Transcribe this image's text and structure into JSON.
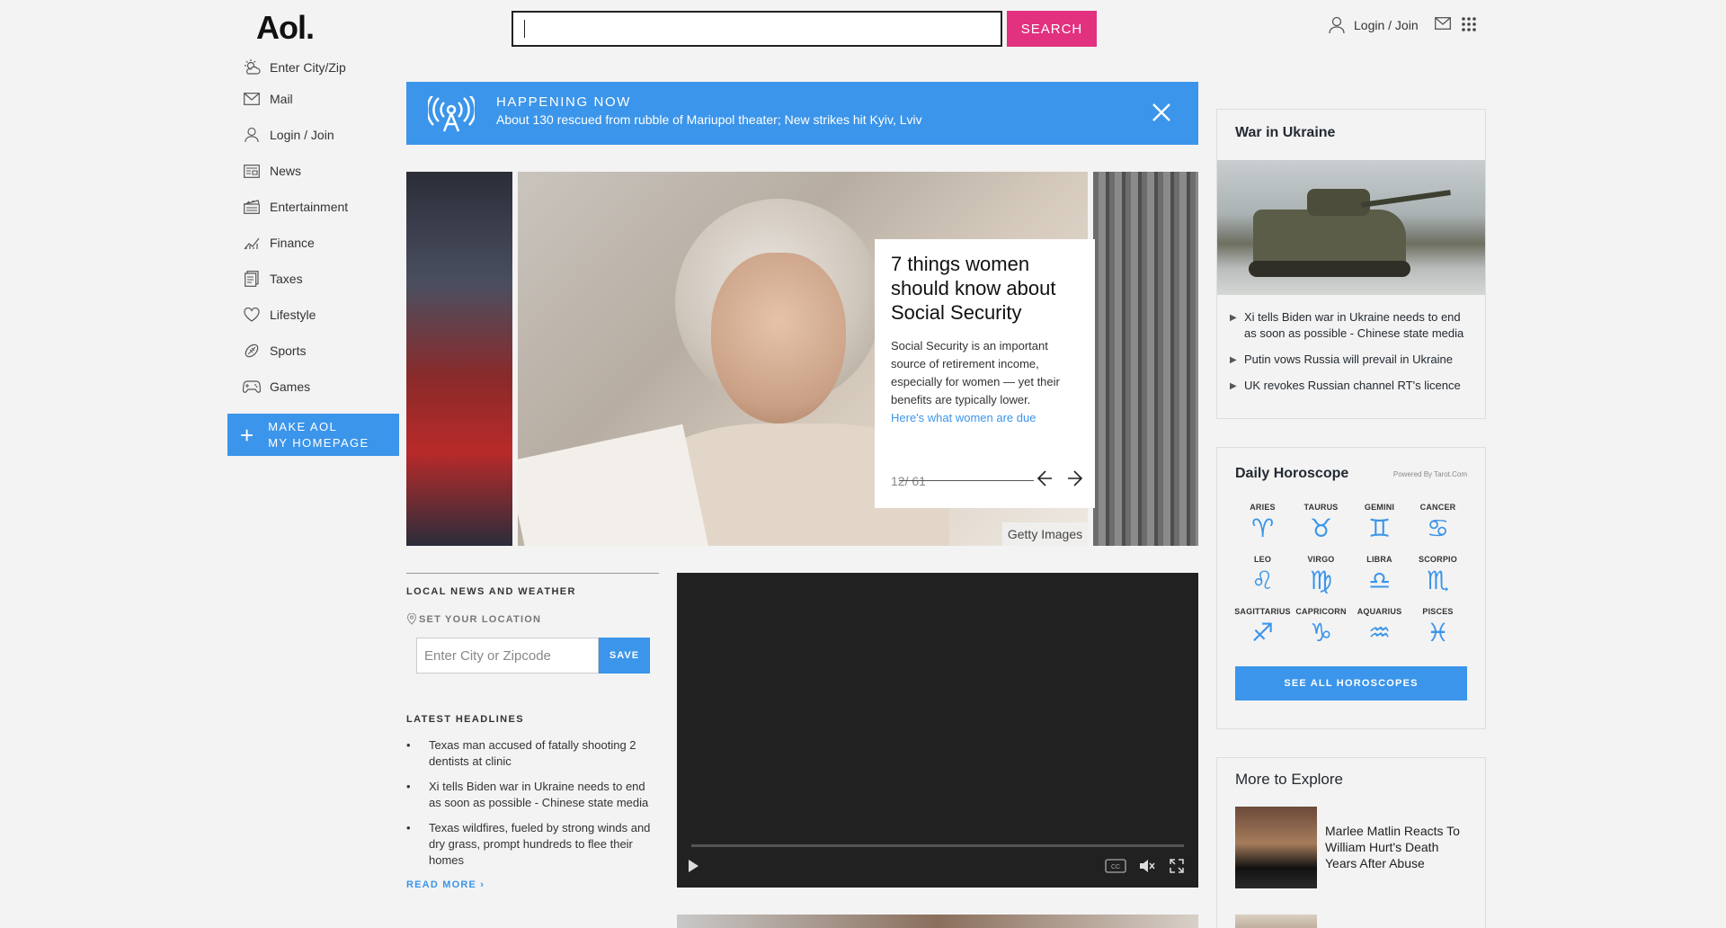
{
  "header": {
    "logo": "Aol.",
    "search_placeholder": "",
    "search_button": "SEARCH",
    "login": "Login / Join",
    "mail_icon": "mail-icon",
    "apps_icon": "grid-icon"
  },
  "sidebar": {
    "items": [
      {
        "label": "Enter City/Zip",
        "icon": "weather-icon"
      },
      {
        "label": "Mail",
        "icon": "mail-icon"
      },
      {
        "label": "Login / Join",
        "icon": "user-icon"
      },
      {
        "label": "News",
        "icon": "news-icon"
      },
      {
        "label": "Entertainment",
        "icon": "clapper-icon"
      },
      {
        "label": "Finance",
        "icon": "chart-icon"
      },
      {
        "label": "Taxes",
        "icon": "document-icon"
      },
      {
        "label": "Lifestyle",
        "icon": "heart-icon"
      },
      {
        "label": "Sports",
        "icon": "ball-icon"
      },
      {
        "label": "Games",
        "icon": "gamepad-icon"
      }
    ],
    "homepage_line1": "MAKE AOL",
    "homepage_line2": "MY HOMEPAGE"
  },
  "happening": {
    "heading": "HAPPENING NOW",
    "text": "About 130 rescued from rubble of Mariupol theater; New strikes hit Kyiv, Lviv"
  },
  "carousel": {
    "title": "7 things women should know about Social Security",
    "description": "Social Security is an important source of retirement income, especially for women — yet their benefits are typically lower.",
    "link": "Here's what women are due",
    "pager": "12/ 61",
    "credit": "Getty Images"
  },
  "local": {
    "heading": "LOCAL NEWS AND WEATHER",
    "set_location": "SET YOUR LOCATION",
    "input_placeholder": "Enter City or Zipcode",
    "save": "SAVE",
    "latest_heading": "LATEST HEADLINES",
    "headlines": [
      "Texas man accused of fatally shooting 2 dentists at clinic",
      "Xi tells Biden war in Ukraine needs to end as soon as possible - Chinese state media",
      "Texas wildfires, fueled by strong winds and dry grass, prompt hundreds to flee their homes"
    ],
    "read_more": "READ MORE ›"
  },
  "ukraine": {
    "title": "War in Ukraine",
    "items": [
      "Xi tells Biden war in Ukraine needs to end as soon as possible - Chinese state media",
      "Putin vows Russia will prevail in Ukraine",
      "UK revokes Russian channel RT's licence"
    ]
  },
  "horoscope": {
    "title": "Daily Horoscope",
    "powered": "Powered By Tarot.Com",
    "signs": [
      {
        "name": "ARIES",
        "glyph": "♈︎"
      },
      {
        "name": "TAURUS",
        "glyph": "♉︎"
      },
      {
        "name": "GEMINI",
        "glyph": "♊︎"
      },
      {
        "name": "CANCER",
        "glyph": "♋︎"
      },
      {
        "name": "LEO",
        "glyph": "♌︎"
      },
      {
        "name": "VIRGO",
        "glyph": "♍︎"
      },
      {
        "name": "LIBRA",
        "glyph": "♎︎"
      },
      {
        "name": "SCORPIO",
        "glyph": "♏︎"
      },
      {
        "name": "SAGITTARIUS",
        "glyph": "♐︎"
      },
      {
        "name": "CAPRICORN",
        "glyph": "♑︎"
      },
      {
        "name": "AQUARIUS",
        "glyph": "♒︎"
      },
      {
        "name": "PISCES",
        "glyph": "♓︎"
      }
    ],
    "see_all": "SEE ALL HOROSCOPES"
  },
  "explore": {
    "title": "More to Explore",
    "item_title": "Marlee Matlin Reacts To William Hurt's Death Years After Abuse"
  },
  "colors": {
    "accent_blue": "#3b95ea",
    "search_pink": "#e2317f"
  }
}
